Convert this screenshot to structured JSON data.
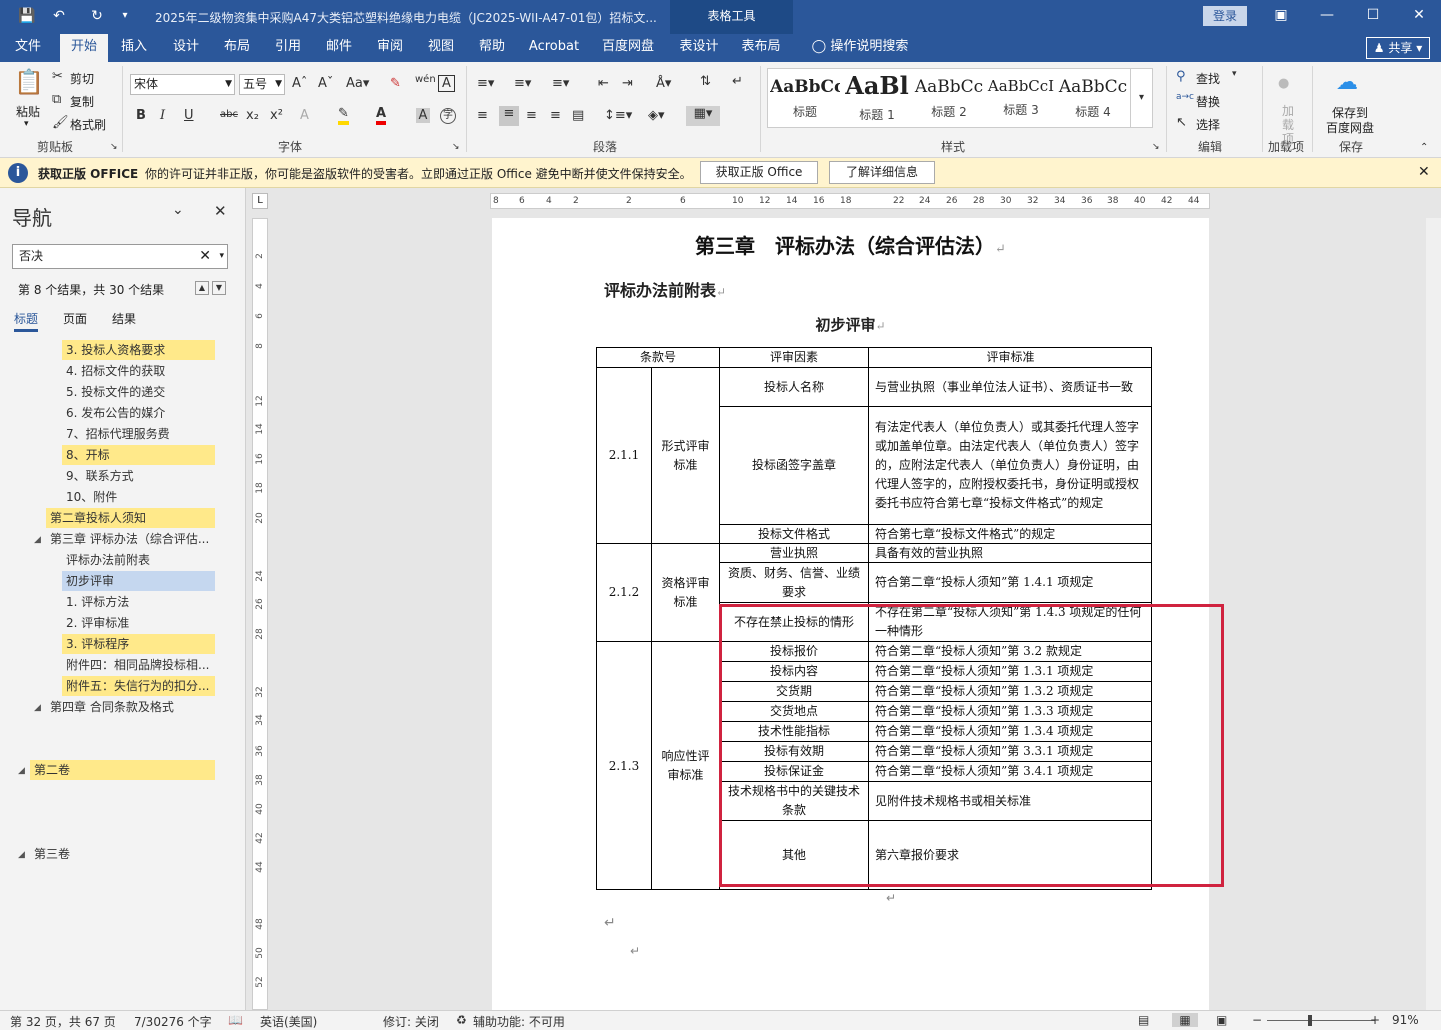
{
  "titlebar": {
    "title": "2025年二级物资集中采购A47大类铝芯塑料绝缘电力电缆（JC2025-WII-A47-01包）招标文...",
    "tools": "表格工具",
    "login": "登录"
  },
  "menu": [
    "文件",
    "开始",
    "插入",
    "设计",
    "布局",
    "引用",
    "邮件",
    "审阅",
    "视图",
    "帮助",
    "Acrobat",
    "百度网盘",
    "表设计",
    "表布局",
    "操作说明搜索"
  ],
  "share": "共享",
  "ribbon": {
    "paste": "粘贴",
    "cut": "剪切",
    "copy": "复制",
    "format_painter": "格式刷",
    "clipboard": "剪贴板",
    "font_name": "宋体",
    "font_size": "五号",
    "font": "字体",
    "paragraph": "段落",
    "styles_label": "样式",
    "styles": [
      {
        "preview": "AaBbCc",
        "name": "标题"
      },
      {
        "preview": "AaBl",
        "name": "标题 1"
      },
      {
        "preview": "AaBbCc",
        "name": "标题 2"
      },
      {
        "preview": "AaBbCcI",
        "name": "标题 3"
      },
      {
        "preview": "AaBbCc",
        "name": "标题 4"
      }
    ],
    "find": "查找",
    "replace": "替换",
    "select": "选择",
    "editing": "编辑",
    "addin": "加载项",
    "addin_btn": "加\n载项",
    "save_to": "保存到",
    "baidu": "百度网盘",
    "save": "保存"
  },
  "infobar": {
    "bold": "获取正版 OFFICE",
    "text": "你的许可证并非正版，你可能是盗版软件的受害者。立即通过正版 Office 避免中断并使文件保持安全。",
    "btn1": "获取正版 Office",
    "btn2": "了解详细信息"
  },
  "nav": {
    "title": "导航",
    "search": "否决",
    "count": "第 8 个结果，共 30 个结果",
    "tabs": [
      "标题",
      "页面",
      "结果"
    ],
    "items": [
      {
        "label": "3. 投标人资格要求",
        "hl": true
      },
      {
        "label": "4. 招标文件的获取"
      },
      {
        "label": "5. 投标文件的递交"
      },
      {
        "label": "6. 发布公告的媒介"
      },
      {
        "label": "7、招标代理服务费"
      },
      {
        "label": "8、开标",
        "hl": true
      },
      {
        "label": "9、联系方式"
      },
      {
        "label": "10、附件"
      },
      {
        "label": "第二章投标人须知",
        "hl": true
      },
      {
        "label": "第三章  评标办法（综合评估..."
      },
      {
        "label": "评标办法前附表"
      },
      {
        "label": "初步评审",
        "sel": true
      },
      {
        "label": "1. 评标方法"
      },
      {
        "label": "2. 评审标准"
      },
      {
        "label": "3. 评标程序",
        "hl": true
      },
      {
        "label": "附件四：相同品牌投标相..."
      },
      {
        "label": "附件五：失信行为的扣分...",
        "hl": true
      },
      {
        "label": "第四章  合同条款及格式"
      },
      {
        "label": "第二卷",
        "hl": true
      },
      {
        "label": "第三卷"
      }
    ]
  },
  "hruler": [
    "8",
    "6",
    "4",
    "2",
    "2",
    "6",
    "10",
    "12",
    "14",
    "16",
    "18",
    "22",
    "24",
    "26",
    "28",
    "30",
    "32",
    "34",
    "36",
    "38",
    "40",
    "42",
    "44"
  ],
  "vruler": [
    "2",
    "4",
    "6",
    "8",
    "12",
    "14",
    "16",
    "18",
    "20",
    "24",
    "26",
    "28",
    "32",
    "34",
    "36",
    "38",
    "40",
    "42",
    "44",
    "48",
    "50",
    "52"
  ],
  "document": {
    "chapter": "第三章　评标办法（综合评估法）",
    "section": "评标办法前附表",
    "subsection": "初步评审",
    "headers": [
      "条款号",
      "评审因素",
      "评审标准"
    ],
    "sections": [
      {
        "no": "2.1.1",
        "type": "形式评审标准"
      },
      {
        "no": "2.1.2",
        "type": "资格评审标准"
      },
      {
        "no": "2.1.3",
        "type": "响应性评审标准"
      }
    ],
    "rows": [
      {
        "factor": "投标人名称",
        "std": "与营业执照（事业单位法人证书）、资质证书一致"
      },
      {
        "factor": "投标函签字盖章",
        "std": "有法定代表人（单位负责人）或其委托代理人签字或加盖单位章。由法定代表人（单位负责人）签字的，应附法定代表人（单位负责人）身份证明，由代理人签字的，应附授权委托书，身份证明或授权委托书应符合第七章“投标文件格式”的规定"
      },
      {
        "factor": "投标文件格式",
        "std": "符合第七章“投标文件格式”的规定"
      },
      {
        "factor": "营业执照",
        "std": "具备有效的营业执照"
      },
      {
        "factor": "资质、财务、信誉、业绩要求",
        "std": "符合第二章“投标人须知”第 1.4.1 项规定"
      },
      {
        "factor": "不存在禁止投标的情形",
        "std": "不存在第二章“投标人须知”第 1.4.3 项规定的任何一种情形"
      },
      {
        "factor": "投标报价",
        "std": "符合第二章“投标人须知”第 3.2 款规定"
      },
      {
        "factor": "投标内容",
        "std": "符合第二章“投标人须知”第 1.3.1 项规定"
      },
      {
        "factor": "交货期",
        "std": "符合第二章“投标人须知”第 1.3.2 项规定"
      },
      {
        "factor": "交货地点",
        "std": "符合第二章“投标人须知”第 1.3.3 项规定"
      },
      {
        "factor": "技术性能指标",
        "std": "符合第二章“投标人须知”第 1.3.4 项规定"
      },
      {
        "factor": "投标有效期",
        "std": "符合第二章“投标人须知”第 3.3.1 项规定"
      },
      {
        "factor": "投标保证金",
        "std": "符合第二章“投标人须知”第 3.4.1 项规定"
      },
      {
        "factor": "技术规格书中的关键技术条款",
        "std": "见附件技术规格书或相关标准"
      },
      {
        "factor": "其他",
        "std": "第六章报价要求"
      }
    ]
  },
  "status": {
    "page": "第 32 页，共 67 页",
    "words": "7/30276 个字",
    "lang": "英语(美国)",
    "track": "修订: 关闭",
    "access": "辅助功能: 不可用",
    "zoom": "91%"
  },
  "colors": {
    "brand": "#2b579a",
    "highlight": "#ffe98a",
    "selected": "#c5d7ef",
    "redbox": "#d0233f",
    "infobar": "#fff4ce"
  }
}
